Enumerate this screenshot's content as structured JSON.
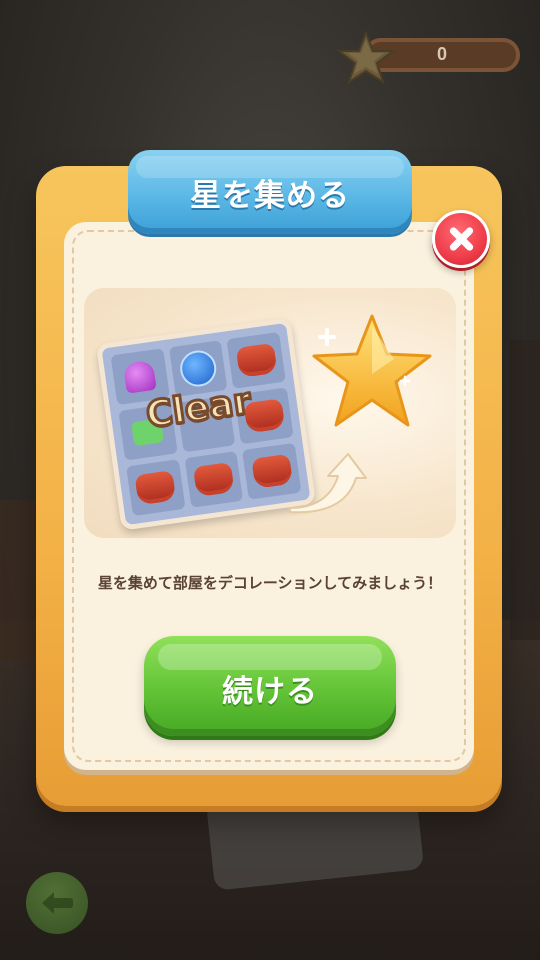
{
  "star_counter": {
    "value": "0",
    "icon": "star-icon"
  },
  "dialog": {
    "title": "星を集める",
    "close_icon": "close-icon",
    "illustration": {
      "board_label": "Clear",
      "star_icon": "star-icon",
      "arrow_icon": "curved-arrow-icon"
    },
    "description": "星を集めて部屋をデコレーションしてみましょう！",
    "continue_label": "続ける"
  },
  "nav": {
    "back_icon": "back-arrow-icon"
  },
  "colors": {
    "dialog_frame": "#f3b146",
    "title_tab": "#5bb8e6",
    "close_button": "#ef3c4a",
    "continue_button": "#62c336",
    "panel_bg": "#fbf1df"
  }
}
